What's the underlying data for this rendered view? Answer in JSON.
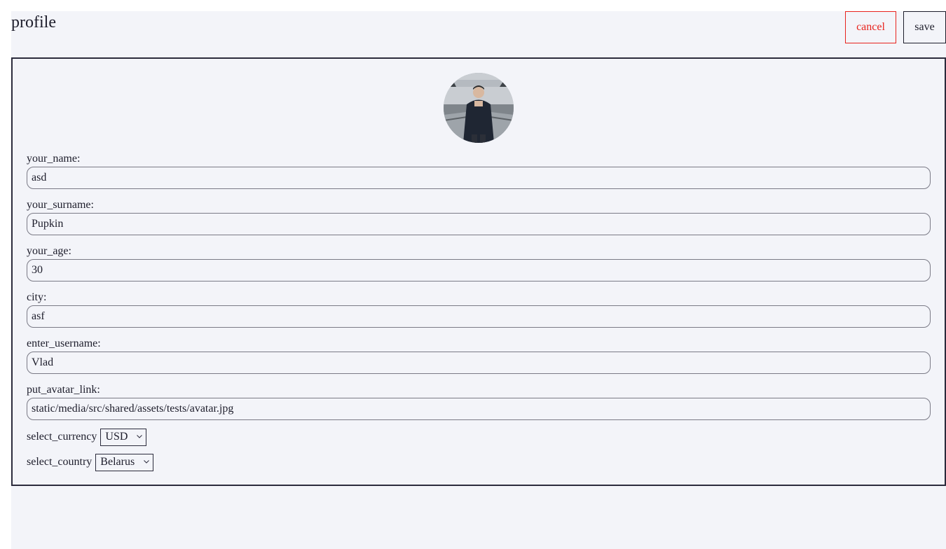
{
  "header": {
    "title": "profile",
    "cancel_label": "cancel",
    "save_label": "save"
  },
  "colors": {
    "cancel": "#e8231d",
    "background": "#f3f4f9",
    "text": "#1d1d2b"
  },
  "form": {
    "fields": [
      {
        "label": "your_name:",
        "value": "asd"
      },
      {
        "label": "your_surname:",
        "value": "Pupkin"
      },
      {
        "label": "your_age:",
        "value": "30"
      },
      {
        "label": "city:",
        "value": "asf"
      },
      {
        "label": "enter_username:",
        "value": "Vlad"
      },
      {
        "label": "put_avatar_link:",
        "value": "static/media/src/shared/assets/tests/avatar.jpg"
      }
    ],
    "currency": {
      "label": "select_currency",
      "value": "USD"
    },
    "country": {
      "label": "select_country",
      "value": "Belarus"
    }
  }
}
